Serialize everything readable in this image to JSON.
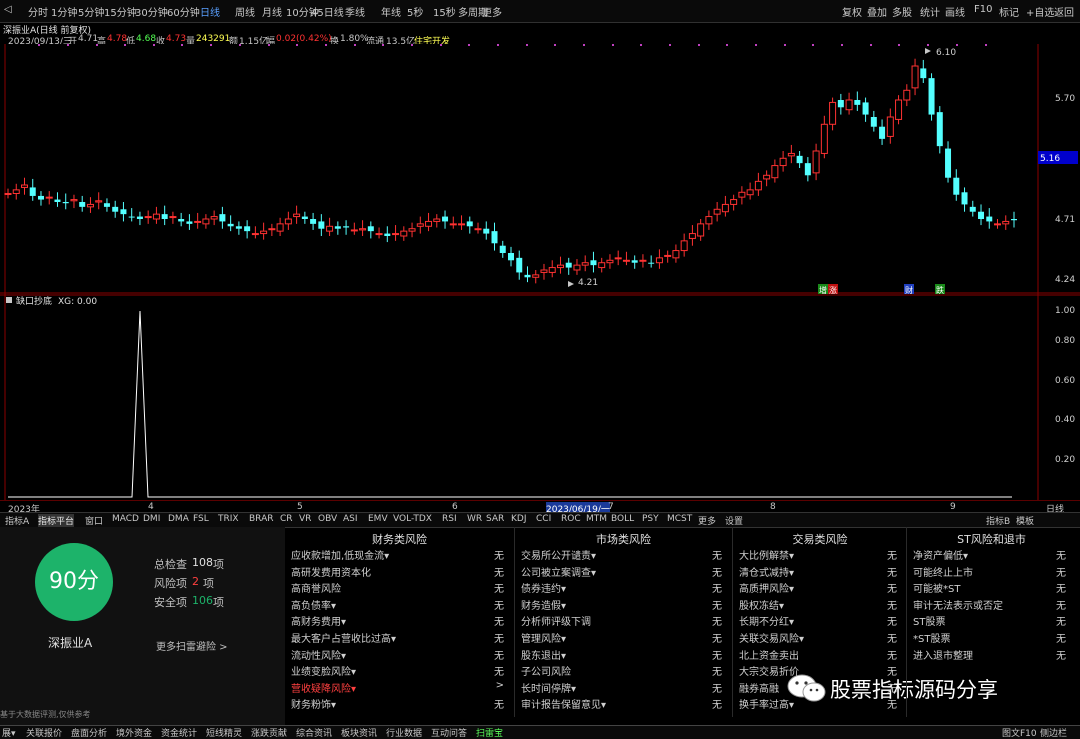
{
  "toolbar": {
    "periods": [
      "分时",
      "1分钟",
      "5分钟",
      "15分钟",
      "30分钟",
      "60分钟",
      "日线",
      "周线",
      "月线",
      "10分钟",
      "45日线",
      "季线",
      "年线",
      "5秒",
      "15秒",
      "多周期",
      "更多"
    ],
    "active_period": "日线",
    "right": [
      "复权",
      "叠加",
      "多股",
      "统计",
      "画线",
      "F10",
      "标记",
      "+自选",
      "返回"
    ]
  },
  "info": {
    "title": "深振业A(日线 前复权)",
    "date": "2023/09/13/三",
    "open_label": "开",
    "open": "4.71",
    "high_label": "高",
    "high": "4.78",
    "low_label": "低",
    "low": "4.68",
    "close_label": "收",
    "close": "4.73",
    "volume_label": "量",
    "volume": "243291",
    "amount_label": "额",
    "amount": "1.15亿",
    "change_label": "幅",
    "change": "0.02(0.42%)",
    "turnover_label": "换",
    "turnover": "1.80%",
    "float_label": "流通",
    "float": "13.5亿",
    "sector": "住宅开发"
  },
  "main_axis": {
    "labels": [
      "5.70",
      "5.16",
      "4.71",
      "4.24"
    ],
    "current_price": "5.16"
  },
  "markers": {
    "high_label": "6.10",
    "low_label": "4.21",
    "tag1": "增",
    "tag2": "涨",
    "tag3": "财",
    "tag4": "跌"
  },
  "sub": {
    "title": "缺口抄底",
    "value": "XG: 0.00",
    "axis": [
      "1.00",
      "0.80",
      "0.60",
      "0.40",
      "0.20"
    ]
  },
  "xaxis": {
    "labels": [
      "2023年",
      "4",
      "5",
      "6",
      "2023/06/19/一",
      "7",
      "8",
      "9"
    ],
    "right": "日线"
  },
  "tabs": {
    "items": [
      "指标A",
      "指标平台",
      "窗口",
      "MACD",
      "DMI",
      "DMA",
      "FSL",
      "TRIX",
      "BRAR",
      "CR",
      "VR",
      "OBV",
      "ASI",
      "EMV",
      "VOL-TDX",
      "RSI",
      "WR",
      "SAR",
      "KDJ",
      "CCI",
      "ROC",
      "MTM",
      "BOLL",
      "PSY",
      "MCST",
      "更多",
      "设置"
    ],
    "right": [
      "指标B",
      "模板"
    ]
  },
  "risk": {
    "score": "90分",
    "stock": "深振业A",
    "total_label": "总检查",
    "total": "108",
    "unit": "项",
    "risk_label": "风险项",
    "risk": "2",
    "safe_label": "安全项",
    "safe": "106",
    "more": "更多扫雷避险 >",
    "disclaimer": "基于大数据评测,仅供参考"
  },
  "columns": [
    {
      "title": "财务类风险",
      "items": [
        {
          "name": "应收款增加,低现金流▾",
          "value": "无"
        },
        {
          "name": "高研发费用资本化",
          "value": "无"
        },
        {
          "name": "高商誉风险",
          "value": "无"
        },
        {
          "name": "高负债率▾",
          "value": "无"
        },
        {
          "name": "高财务费用▾",
          "value": "无"
        },
        {
          "name": "最大客户占营收比过高▾",
          "value": "无"
        },
        {
          "name": "流动性风险▾",
          "value": "无"
        },
        {
          "name": "业绩变脸风险▾",
          "value": "无"
        },
        {
          "name": "营收疑降风险▾",
          "value": ">"
        },
        {
          "name": "财务粉饰▾",
          "value": "无"
        }
      ]
    },
    {
      "title": "市场类风险",
      "items": [
        {
          "name": "交易所公开谴责▾",
          "value": "无"
        },
        {
          "name": "公司被立案调查▾",
          "value": "无"
        },
        {
          "name": "债券违约▾",
          "value": "无"
        },
        {
          "name": "财务造假▾",
          "value": "无"
        },
        {
          "name": "分析师评级下调",
          "value": "无"
        },
        {
          "name": "管理风险▾",
          "value": "无"
        },
        {
          "name": "股东退出▾",
          "value": "无"
        },
        {
          "name": "子公司风险",
          "value": "无"
        },
        {
          "name": "长时间停牌▾",
          "value": "无"
        },
        {
          "name": "审计报告保留意见▾",
          "value": "无"
        }
      ]
    },
    {
      "title": "交易类风险",
      "items": [
        {
          "name": "大比例解禁▾",
          "value": "无"
        },
        {
          "name": "清仓式减持▾",
          "value": "无"
        },
        {
          "name": "高质押风险▾",
          "value": "无"
        },
        {
          "name": "股权冻结▾",
          "value": "无"
        },
        {
          "name": "长期不分红▾",
          "value": "无"
        },
        {
          "name": "关联交易风险▾",
          "value": "无"
        },
        {
          "name": "北上资金卖出",
          "value": "无"
        },
        {
          "name": "大宗交易折价",
          "value": "无"
        },
        {
          "name": "融券高融",
          "value": "无"
        },
        {
          "name": "换手率过高▾",
          "value": "无"
        }
      ]
    },
    {
      "title": "ST风险和退市",
      "items": [
        {
          "name": "净资产偏低▾",
          "value": "无"
        },
        {
          "name": "可能终止上市",
          "value": "无"
        },
        {
          "name": "可能被*ST",
          "value": "无"
        },
        {
          "name": "审计无法表示或否定",
          "value": "无"
        },
        {
          "name": "ST股票",
          "value": "无"
        },
        {
          "name": "*ST股票",
          "value": "无"
        },
        {
          "name": "进入退市整理",
          "value": "无"
        }
      ]
    }
  ],
  "bottom": {
    "items": [
      "展▾",
      "关联报价",
      "盘面分析",
      "境外资金",
      "资金统计",
      "短线精灵",
      "涨跌贡献",
      "综合资讯",
      "板块资讯",
      "行业数据",
      "互动问答",
      "扫雷宝"
    ],
    "active": "扫雷宝",
    "right": [
      "图文F10",
      "侧边栏"
    ]
  },
  "watermark": "股票指标源码分享",
  "colors": {
    "up": "#ff3232",
    "down": "#54ffff",
    "accent": "#5aa0ff",
    "score_bg": "#1db36a"
  }
}
